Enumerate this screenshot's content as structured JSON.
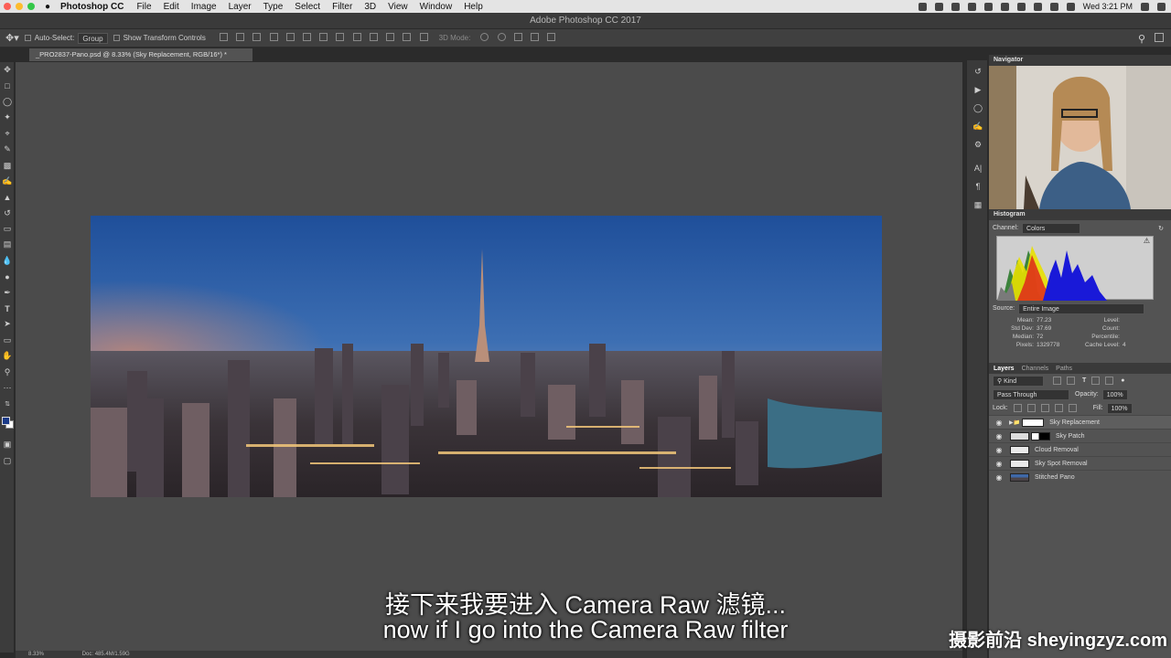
{
  "menubar": {
    "app_name": "Photoshop CC",
    "items": [
      "File",
      "Edit",
      "Image",
      "Layer",
      "Type",
      "Select",
      "Filter",
      "3D",
      "View",
      "Window",
      "Help"
    ],
    "clock": "Wed 3:21 PM"
  },
  "window": {
    "title": "Adobe Photoshop CC 2017"
  },
  "options": {
    "auto_select_label": "Auto-Select:",
    "auto_select_value": "Group",
    "transform_label": "Show Transform Controls",
    "mode_3d_label": "3D Mode:"
  },
  "document": {
    "tab_title": "_PRO2837-Pano.psd @ 8.33% (Sky Replacement, RGB/16*) *",
    "zoom": "8.33%",
    "doc_info": "Doc: 485.4M/1.59G"
  },
  "navigator": {
    "title": "Navigator"
  },
  "histogram": {
    "title": "Histogram",
    "channel_label": "Channel:",
    "channel_value": "Colors",
    "source_label": "Source:",
    "source_value": "Entire Image",
    "stats": [
      {
        "k": "Mean:",
        "v": "77.23",
        "k2": "Level:",
        "v2": ""
      },
      {
        "k": "Std Dev:",
        "v": "37.69",
        "k2": "Count:",
        "v2": ""
      },
      {
        "k": "Median:",
        "v": "72",
        "k2": "Percentile:",
        "v2": ""
      },
      {
        "k": "Pixels:",
        "v": "1329778",
        "k2": "Cache Level:",
        "v2": "4"
      }
    ]
  },
  "layers_panel": {
    "tabs": [
      "Layers",
      "Channels",
      "Paths"
    ],
    "filter_label": "Kind",
    "blend_mode": "Pass Through",
    "opacity_label": "Opacity:",
    "opacity_value": "100%",
    "lock_label": "Lock:",
    "fill_label": "Fill:",
    "fill_value": "100%",
    "layers": [
      {
        "name": "Sky Replacement"
      },
      {
        "name": "Sky Patch"
      },
      {
        "name": "Cloud Removal"
      },
      {
        "name": "Sky Spot Removal"
      },
      {
        "name": "Stitched Pano"
      }
    ]
  },
  "subtitles": {
    "zh": "接下来我要进入 Camera Raw 滤镜...",
    "en": "now if I go into the Camera Raw filter"
  },
  "watermark": "摄影前沿 sheyingzyz.com",
  "colors": {
    "fg_swatch": "#1b3a88",
    "bg_swatch": "#ffffff",
    "close_dot": "#fc5f57",
    "min_dot": "#fdbc2e",
    "max_dot": "#33c748"
  }
}
